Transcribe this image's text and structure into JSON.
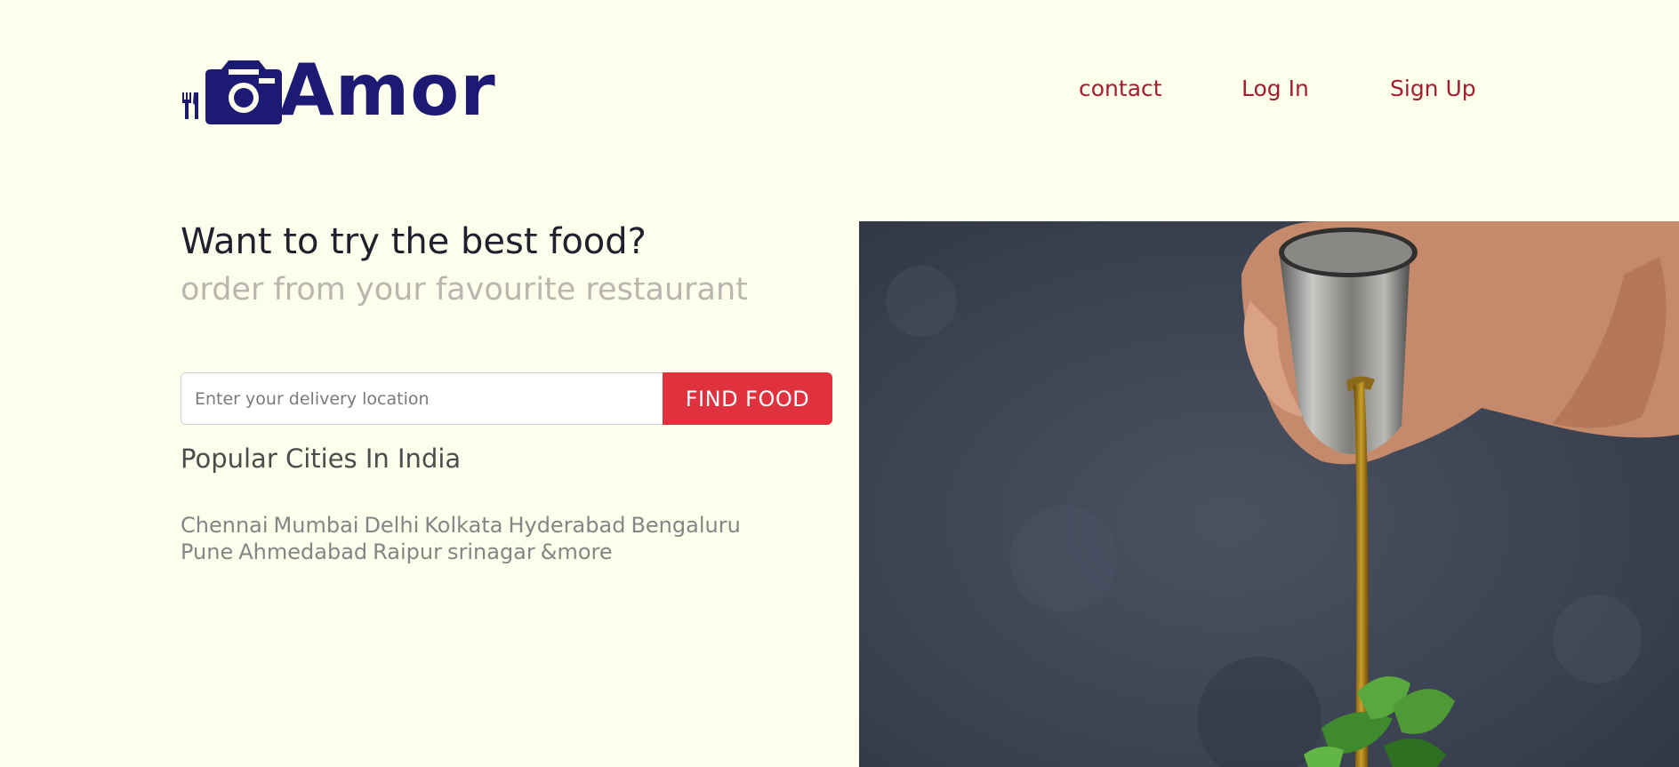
{
  "header": {
    "logo": {
      "text": "Amor",
      "icons": [
        "fork-knife-icon",
        "camera-icon"
      ]
    },
    "nav": [
      {
        "label": "contact"
      },
      {
        "label": "Log In"
      },
      {
        "label": "Sign Up"
      }
    ]
  },
  "hero": {
    "title": "Want to try the best food?",
    "subtitle": "order from your favourite restaurant",
    "search": {
      "placeholder": "Enter your delivery location",
      "value": "",
      "button_label": "FIND FOOD"
    },
    "popular": {
      "title": "Popular Cities In India",
      "cities": [
        "Chennai",
        "Mumbai",
        "Delhi",
        "Kolkata",
        "Hyderabad",
        "Bengaluru",
        "Pune",
        "Ahmedabad",
        "Raipur",
        "srinagar",
        "&more"
      ]
    }
  },
  "colors": {
    "background": "#fefeec",
    "brand": "#1c1a73",
    "nav_link": "#a31d2c",
    "accent_button": "#e0313f"
  }
}
